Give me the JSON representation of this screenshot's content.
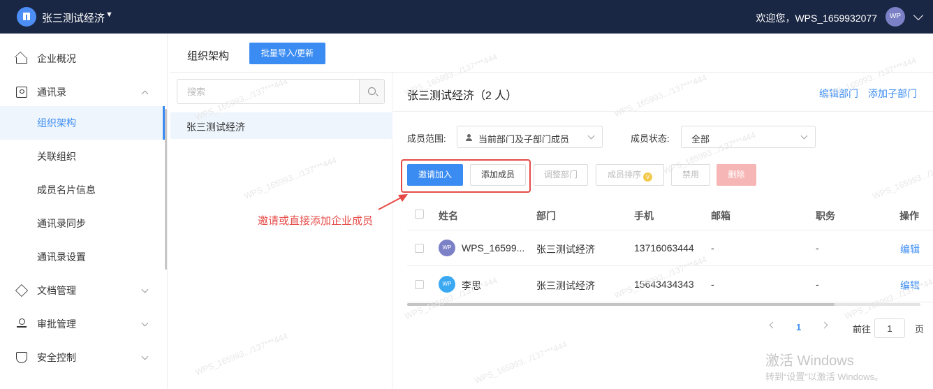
{
  "topbar": {
    "org_name": "张三测试经济",
    "welcome": "欢迎您，WPS_1659932077",
    "avatar_text": "WP"
  },
  "sidebar": {
    "items": [
      {
        "label": "企业概况"
      },
      {
        "label": "通讯录"
      },
      {
        "label": "组织架构"
      },
      {
        "label": "关联组织"
      },
      {
        "label": "成员名片信息"
      },
      {
        "label": "通讯录同步"
      },
      {
        "label": "通讯录设置"
      },
      {
        "label": "文档管理"
      },
      {
        "label": "审批管理"
      },
      {
        "label": "安全控制"
      }
    ]
  },
  "page": {
    "title": "组织架构",
    "import_button": "批量导入/更新"
  },
  "tree": {
    "search_placeholder": "搜索",
    "node": "张三测试经济"
  },
  "department": {
    "title": "张三测试经济（2 人）",
    "edit_link": "编辑部门",
    "add_sub_link": "添加子部门"
  },
  "filters": {
    "scope_label": "成员范围:",
    "scope_value": "当前部门及子部门成员",
    "status_label": "成员状态:",
    "status_value": "全部"
  },
  "actions": {
    "invite": "邀请加入",
    "add_member": "添加成员",
    "adjust_dept": "调整部门",
    "sort_members": "成员排序",
    "sort_badge": "V",
    "disable": "禁用",
    "delete": "删除"
  },
  "table": {
    "columns": [
      "姓名",
      "部门",
      "手机",
      "邮箱",
      "职务",
      "操作"
    ],
    "rows": [
      {
        "avatar": "WP",
        "avatar_color": "#7b80c7",
        "name": "WPS_16599...",
        "dept": "张三测试经济",
        "phone": "13716063444",
        "email": "-",
        "title": "-",
        "op": "编辑"
      },
      {
        "avatar": "WP",
        "avatar_color": "#3ba9f2",
        "name": "李思",
        "dept": "张三测试经济",
        "phone": "15643434343",
        "email": "-",
        "title": "-",
        "op": "编辑"
      }
    ]
  },
  "pagination": {
    "current": "1",
    "goto_label": "前往",
    "goto_value": "1",
    "unit": "页"
  },
  "annotation": {
    "text": "邀请或直接添加企业成员"
  },
  "watermark": "WPS_165993.../137***444",
  "activation": {
    "line1": "激活 Windows",
    "line2": "转到“设置”以激活 Windows。"
  },
  "colors": {
    "topbar_bg": "#1a2744",
    "accent": "#3b8cf2",
    "highlight_red": "#e64a46",
    "active_bg": "#eef5fd"
  }
}
